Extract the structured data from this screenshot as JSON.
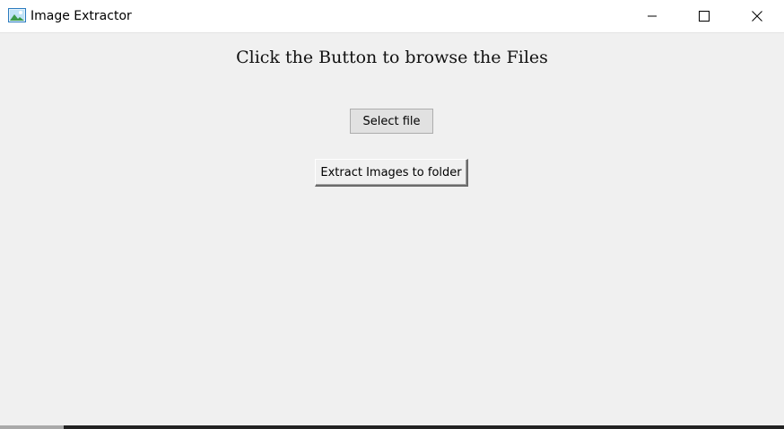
{
  "window": {
    "title": "Image Extractor"
  },
  "caption_buttons": {
    "minimize": "minimize-icon",
    "maximize": "maximize-icon",
    "close": "close-icon"
  },
  "main": {
    "heading": "Click the Button to browse the Files",
    "select_button_label": "Select file",
    "extract_button_label": "Extract Images to folder"
  },
  "colors": {
    "window_bg": "#f0f0f0",
    "titlebar_bg": "#ffffff",
    "button_bg": "#e1e1e1",
    "button_border": "#adadad"
  }
}
